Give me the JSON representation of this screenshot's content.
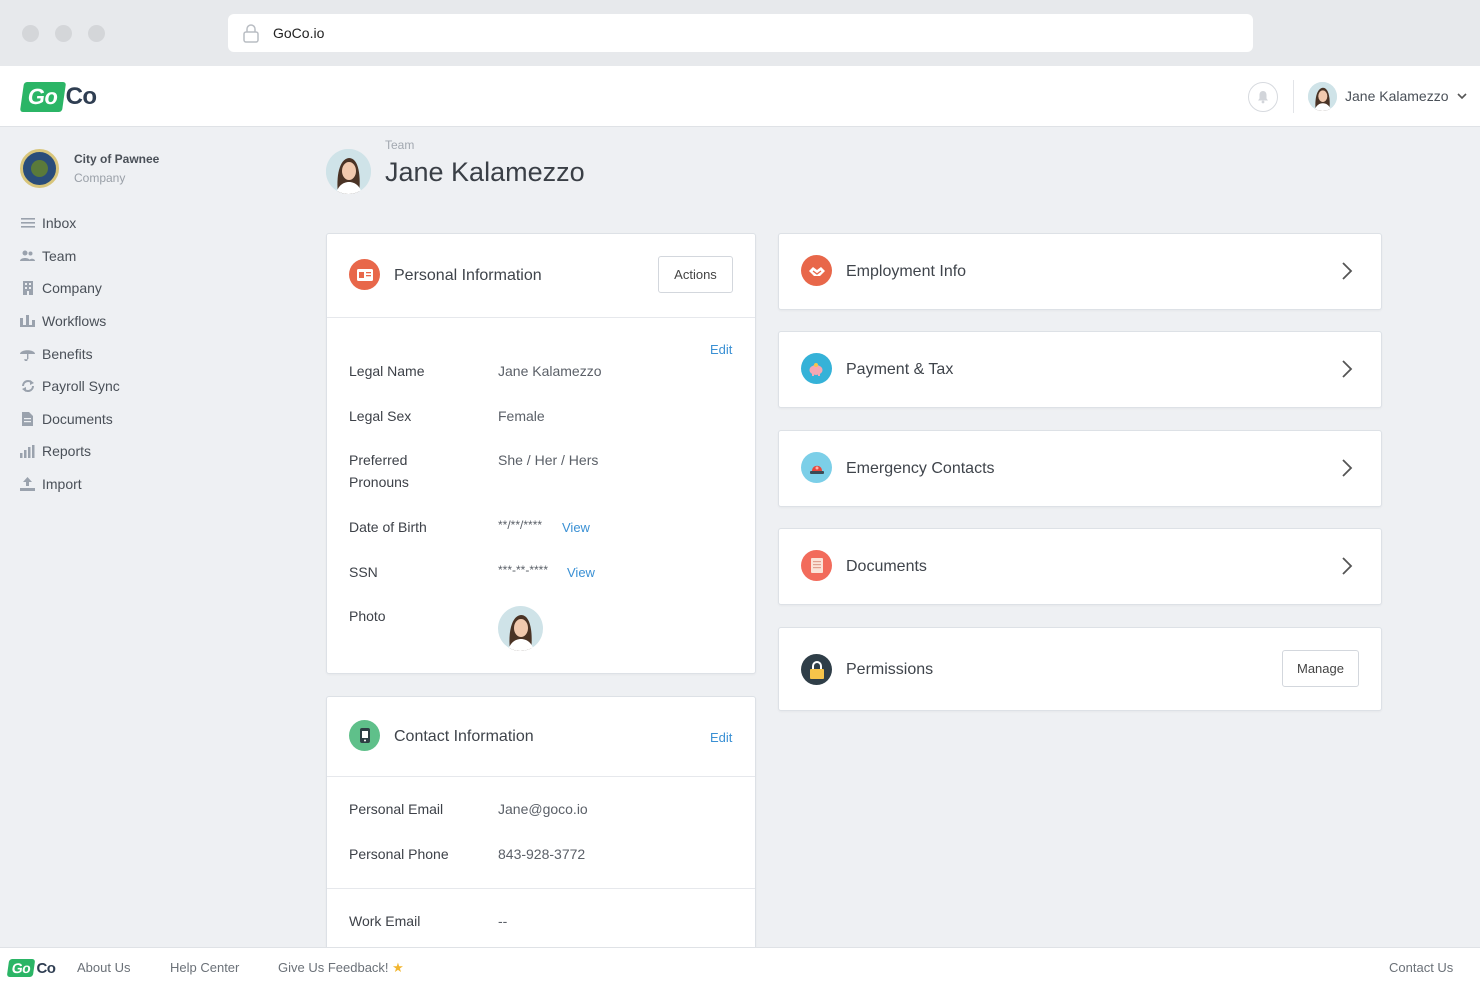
{
  "browser": {
    "url": "GoCo.io"
  },
  "brand": {
    "logo_go": "Go",
    "logo_co": "Co",
    "accent": "#2bb566"
  },
  "header": {
    "user_name": "Jane Kalamezzo"
  },
  "sidebar": {
    "company_name": "City of Pawnee",
    "company_sub": "Company",
    "items": [
      {
        "label": "Inbox",
        "icon": "list-icon"
      },
      {
        "label": "Team",
        "icon": "people-icon"
      },
      {
        "label": "Company",
        "icon": "building-icon"
      },
      {
        "label": "Workflows",
        "icon": "workflow-icon"
      },
      {
        "label": "Benefits",
        "icon": "umbrella-icon"
      },
      {
        "label": "Payroll Sync",
        "icon": "sync-icon"
      },
      {
        "label": "Documents",
        "icon": "document-icon"
      },
      {
        "label": "Reports",
        "icon": "bar-chart-icon"
      },
      {
        "label": "Import",
        "icon": "upload-icon"
      }
    ]
  },
  "page": {
    "breadcrumb": "Team",
    "title": "Jane Kalamezzo"
  },
  "personal": {
    "title": "Personal Information",
    "actions_label": "Actions",
    "edit_label": "Edit",
    "fields": {
      "legal_name": {
        "label": "Legal Name",
        "value": "Jane Kalamezzo"
      },
      "legal_sex": {
        "label": "Legal Sex",
        "value": "Female"
      },
      "pronouns": {
        "label": "Preferred Pronouns",
        "value": "She / Her / Hers"
      },
      "dob": {
        "label": "Date of Birth",
        "value": "**/**/****",
        "link": "View"
      },
      "ssn": {
        "label": "SSN",
        "value": "***-**-****",
        "link": "View"
      },
      "photo": {
        "label": "Photo"
      }
    }
  },
  "contact": {
    "title": "Contact Information",
    "edit_label": "Edit",
    "fields": {
      "personal_email": {
        "label": "Personal Email",
        "value": "Jane@goco.io"
      },
      "personal_phone": {
        "label": "Personal Phone",
        "value": "843-928-3772"
      },
      "work_email": {
        "label": "Work Email",
        "value": "--"
      }
    }
  },
  "sections": [
    {
      "title": "Employment Info",
      "icon": "handshake-icon",
      "color": "#e8674a"
    },
    {
      "title": "Payment & Tax",
      "icon": "piggy-bank-icon",
      "color": "#35b2d8"
    },
    {
      "title": "Emergency Contacts",
      "icon": "siren-icon",
      "color": "#7ccfe8"
    },
    {
      "title": "Documents",
      "icon": "document-icon",
      "color": "#f26b5b"
    }
  ],
  "permissions": {
    "title": "Permissions",
    "manage_label": "Manage",
    "icon": "lock-icon"
  },
  "footer": {
    "about": "About Us",
    "help": "Help Center",
    "feedback": "Give Us Feedback!",
    "contact": "Contact Us"
  }
}
